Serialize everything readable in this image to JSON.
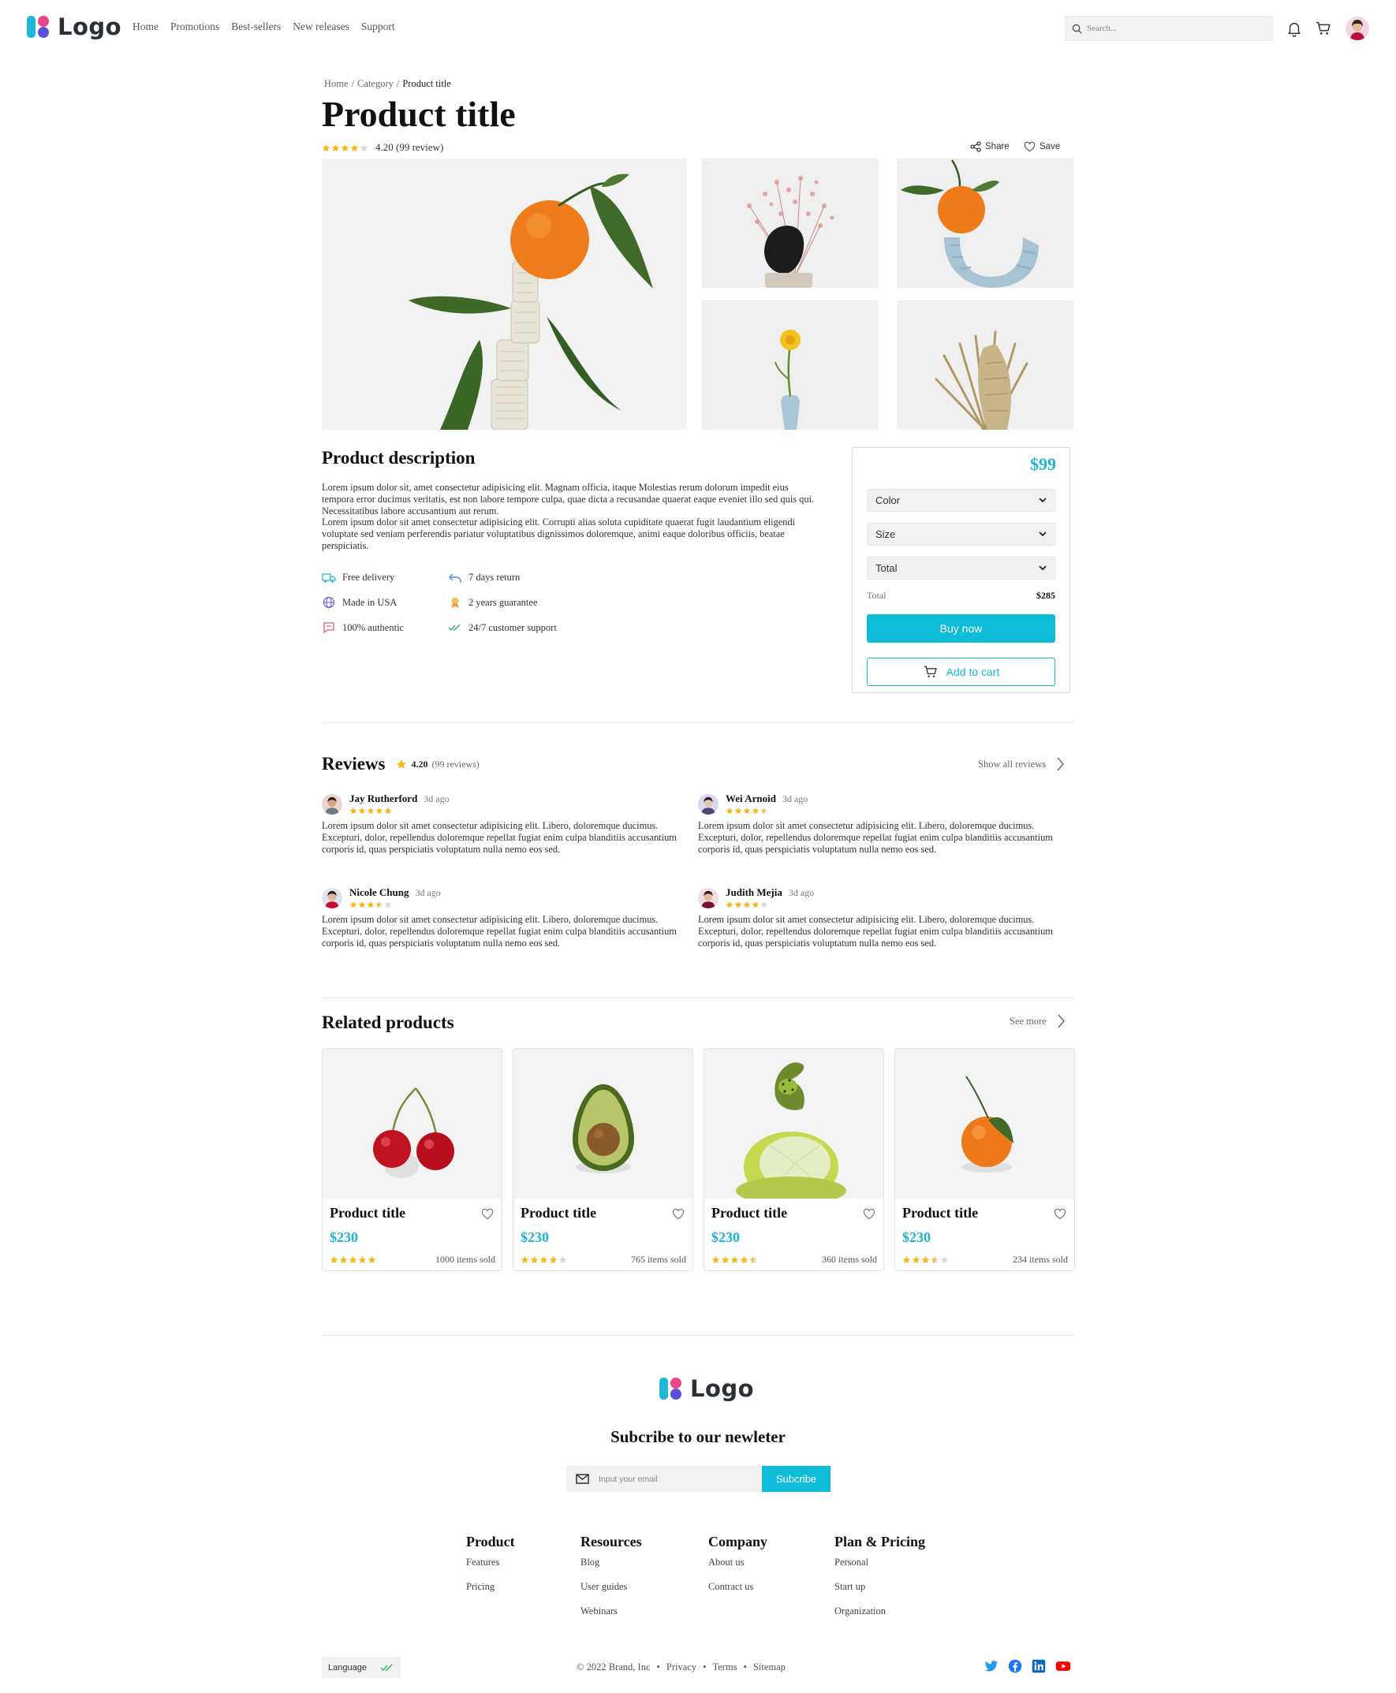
{
  "header": {
    "logo_text": "Logo",
    "nav": [
      "Home",
      "Promotions",
      "Best-sellers",
      "New releases",
      "Support"
    ],
    "search_placeholder": "Search..."
  },
  "product": {
    "breadcrumb": [
      "Home",
      "Category",
      "Product title"
    ],
    "breadcrumb_sep": "/",
    "title": "Product title",
    "rating": 4.2,
    "rating_text": "4.20 (99 review)",
    "share_label": "Share",
    "save_label": "Save",
    "description_title": "Product description",
    "description_p1": "Lorem ipsum dolor sit, amet consectetur adipisicing elit. Magnam officia, itaque Molestias rerum dolorum impedit eius tempora error ducimus veritatis, est non labore tempore culpa, quae dicta a recusandae quaerat eaque eveniet illo sed quis qui. Necessitatibus labore accusantium aut rerum.",
    "description_p2": "Lorem ipsum dolor sit amet consectetur adipisicing elit. Corrupti alias soluta cupiditate quaerat fugit laudantium eligendi voluptate sed veniam perferendis pariatur voluptatibus dignissimos doloremque, animi eaque doloribus officiis, beatae perspiciatis.",
    "features": [
      {
        "icon": "truck-icon",
        "label": "Free delivery"
      },
      {
        "icon": "return-arrow-icon",
        "label": "7 days return"
      },
      {
        "icon": "globe-icon",
        "label": "Made in USA"
      },
      {
        "icon": "award-icon",
        "label": "2 years guarantee"
      },
      {
        "icon": "chat-icon",
        "label": "100% authentic"
      },
      {
        "icon": "double-check-icon",
        "label": "24/7 customer support"
      }
    ]
  },
  "buybox": {
    "price": "$99",
    "selects": [
      "Color",
      "Size",
      "Total"
    ],
    "total_label": "Total",
    "total_value": "$285",
    "buy_label": "Buy now",
    "cart_label": "Add to cart"
  },
  "reviews": {
    "title": "Reviews",
    "rating": "4.20",
    "count": "(99 reviews)",
    "show_all": "Show all reviews",
    "items": [
      {
        "name": "Jay Rutherford",
        "time": "3d ago",
        "stars": 5,
        "text": "Lorem ipsum dolor sit amet consectetur adipisicing elit. Libero, doloremque ducimus. Excepturi, dolor, repellendus doloremque repellat fugiat enim culpa blanditiis accusantium corporis id, quas perspiciatis voluptatum nulla nemo eos sed."
      },
      {
        "name": "Wei Arnoid",
        "time": "3d ago",
        "stars": 4.5,
        "text": "Lorem ipsum dolor sit amet consectetur adipisicing elit. Libero, doloremque ducimus. Excepturi, dolor, repellendus doloremque repellat fugiat enim culpa blanditiis accusantium corporis id, quas perspiciatis voluptatum nulla nemo eos sed."
      },
      {
        "name": "Nicole Chung",
        "time": "3d ago",
        "stars": 3.5,
        "text": "Lorem ipsum dolor sit amet consectetur adipisicing elit. Libero, doloremque ducimus. Excepturi, dolor, repellendus doloremque repellat fugiat enim culpa blanditiis accusantium corporis id, quas perspiciatis voluptatum nulla nemo eos sed."
      },
      {
        "name": "Judith Mejia",
        "time": "3d ago",
        "stars": 4,
        "text": "Lorem ipsum dolor sit amet consectetur adipisicing elit. Libero, doloremque ducimus. Excepturi, dolor, repellendus doloremque repellat fugiat enim culpa blanditiis accusantium corporis id, quas perspiciatis voluptatum nulla nemo eos sed."
      }
    ]
  },
  "related": {
    "title": "Related products",
    "see_more": "See more",
    "items": [
      {
        "title": "Product title",
        "price": "$230",
        "stars": 5,
        "sold": "1000 items sold",
        "fruit": "cherry"
      },
      {
        "title": "Product title",
        "price": "$230",
        "stars": 4,
        "sold": "765 items sold",
        "fruit": "avocado"
      },
      {
        "title": "Product title",
        "price": "$230",
        "stars": 4.5,
        "sold": "360 items sold",
        "fruit": "kiwi"
      },
      {
        "title": "Product title",
        "price": "$230",
        "stars": 3.5,
        "sold": "234 items sold",
        "fruit": "orange"
      }
    ]
  },
  "footer": {
    "logo_text": "Logo",
    "newsletter_title": "Subcribe to our newleter",
    "email_placeholder": "Input your email",
    "subscribe_label": "Subcribe",
    "columns": [
      {
        "title": "Product",
        "links": [
          "Features",
          "Pricing"
        ]
      },
      {
        "title": "Resources",
        "links": [
          "Blog",
          "User guides",
          "Webinars"
        ]
      },
      {
        "title": "Company",
        "links": [
          "About us",
          "Contract us"
        ]
      },
      {
        "title": "Plan & Pricing",
        "links": [
          "Personal",
          "Start up",
          "Organization"
        ]
      }
    ],
    "language_label": "Language",
    "copyright": "© 2022 Brand, Inc",
    "legal_links": [
      "Privacy",
      "Terms",
      "Sitemap"
    ],
    "social": [
      "twitter-icon",
      "facebook-icon",
      "linkedin-icon",
      "youtube-icon"
    ]
  },
  "colors": {
    "accent": "#0fbcd8",
    "price": "#1eb4d6",
    "star": "#f5b914",
    "star_empty": "#d9d9d9"
  }
}
